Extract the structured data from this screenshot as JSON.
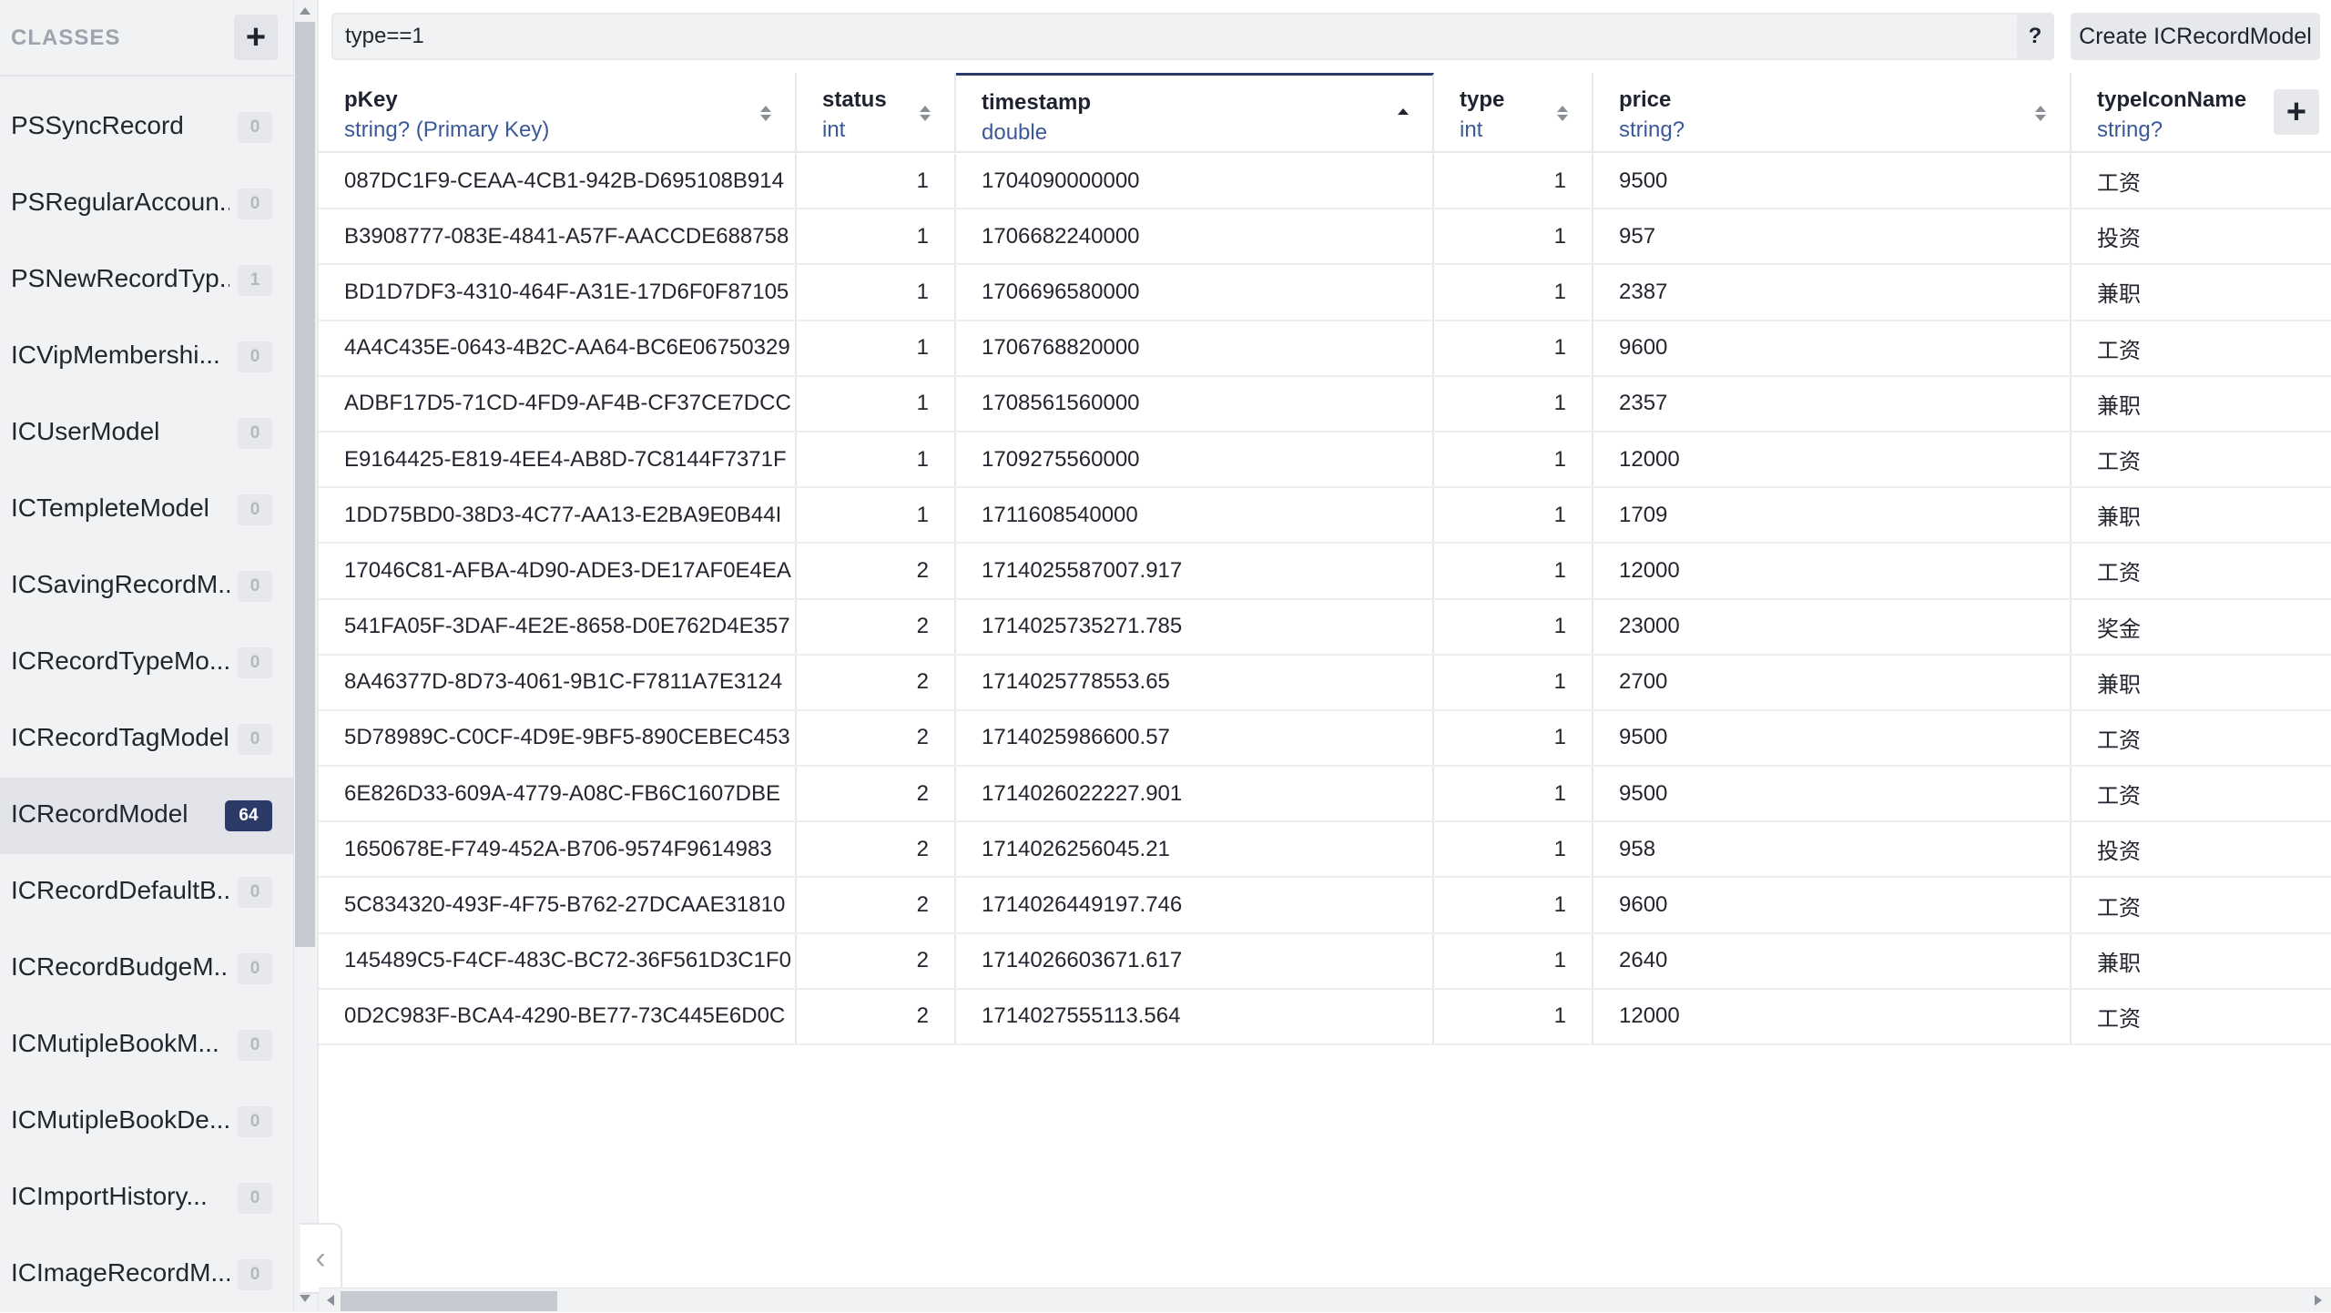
{
  "sidebar": {
    "title": "CLASSES",
    "add_label": "+",
    "items": [
      {
        "label": "PSSyncRecord",
        "count": "0"
      },
      {
        "label": "PSRegularAccoun...",
        "count": "0"
      },
      {
        "label": "PSNewRecordTyp...",
        "count": "1"
      },
      {
        "label": "ICVipMembershi...",
        "count": "0"
      },
      {
        "label": "ICUserModel",
        "count": "0"
      },
      {
        "label": "ICTempleteModel",
        "count": "0"
      },
      {
        "label": "ICSavingRecordM...",
        "count": "0"
      },
      {
        "label": "ICRecordTypeMo...",
        "count": "0"
      },
      {
        "label": "ICRecordTagModel",
        "count": "0"
      },
      {
        "label": "ICRecordModel",
        "count": "64",
        "active": true
      },
      {
        "label": "ICRecordDefaultB...",
        "count": "0"
      },
      {
        "label": "ICRecordBudgeM...",
        "count": "0"
      },
      {
        "label": "ICMutipleBookM...",
        "count": "0"
      },
      {
        "label": "ICMutipleBookDe...",
        "count": "0"
      },
      {
        "label": "ICImportHistory...",
        "count": "0"
      },
      {
        "label": "ICImageRecordM...",
        "count": "0"
      }
    ],
    "collapse_icon": "chevron-left-icon"
  },
  "toolbar": {
    "query_value": "type==1",
    "help_label": "?",
    "create_label": "Create ICRecordModel"
  },
  "table": {
    "add_column_label": "+",
    "columns": [
      {
        "name": "pKey",
        "type": "string? (Primary Key)"
      },
      {
        "name": "status",
        "type": "int"
      },
      {
        "name": "timestamp",
        "type": "double",
        "sorted": "asc"
      },
      {
        "name": "type",
        "type": "int"
      },
      {
        "name": "price",
        "type": "string?"
      },
      {
        "name": "typeIconName",
        "type": "string?"
      }
    ],
    "rows": [
      [
        "087DC1F9-CEAA-4CB1-942B-D695108B914",
        "1",
        "1704090000000",
        "1",
        "9500",
        "工资"
      ],
      [
        "B3908777-083E-4841-A57F-AACCDE688758",
        "1",
        "1706682240000",
        "1",
        "957",
        "投资"
      ],
      [
        "BD1D7DF3-4310-464F-A31E-17D6F0F87105",
        "1",
        "1706696580000",
        "1",
        "2387",
        "兼职"
      ],
      [
        "4A4C435E-0643-4B2C-AA64-BC6E06750329",
        "1",
        "1706768820000",
        "1",
        "9600",
        "工资"
      ],
      [
        "ADBF17D5-71CD-4FD9-AF4B-CF37CE7DCC",
        "1",
        "1708561560000",
        "1",
        "2357",
        "兼职"
      ],
      [
        "E9164425-E819-4EE4-AB8D-7C8144F7371F",
        "1",
        "1709275560000",
        "1",
        "12000",
        "工资"
      ],
      [
        "1DD75BD0-38D3-4C77-AA13-E2BA9E0B44I",
        "1",
        "1711608540000",
        "1",
        "1709",
        "兼职"
      ],
      [
        "17046C81-AFBA-4D90-ADE3-DE17AF0E4EA",
        "2",
        "1714025587007.917",
        "1",
        "12000",
        "工资"
      ],
      [
        "541FA05F-3DAF-4E2E-8658-D0E762D4E357",
        "2",
        "1714025735271.785",
        "1",
        "23000",
        "奖金"
      ],
      [
        "8A46377D-8D73-4061-9B1C-F7811A7E3124",
        "2",
        "1714025778553.65",
        "1",
        "2700",
        "兼职"
      ],
      [
        "5D78989C-C0CF-4D9E-9BF5-890CEBEC453",
        "2",
        "1714025986600.57",
        "1",
        "9500",
        "工资"
      ],
      [
        "6E826D33-609A-4779-A08C-FB6C1607DBE",
        "2",
        "1714026022227.901",
        "1",
        "9500",
        "工资"
      ],
      [
        "1650678E-F749-452A-B706-9574F9614983",
        "2",
        "1714026256045.21",
        "1",
        "958",
        "投资"
      ],
      [
        "5C834320-493F-4F75-B762-27DCAAE31810",
        "2",
        "1714026449197.746",
        "1",
        "9600",
        "工资"
      ],
      [
        "145489C5-F4CF-483C-BC72-36F561D3C1F0",
        "2",
        "1714026603671.617",
        "1",
        "2640",
        "兼职"
      ],
      [
        "0D2C983F-BCA4-4290-BE77-73C445E6D0C",
        "2",
        "1714027555113.564",
        "1",
        "12000",
        "工资"
      ]
    ]
  }
}
